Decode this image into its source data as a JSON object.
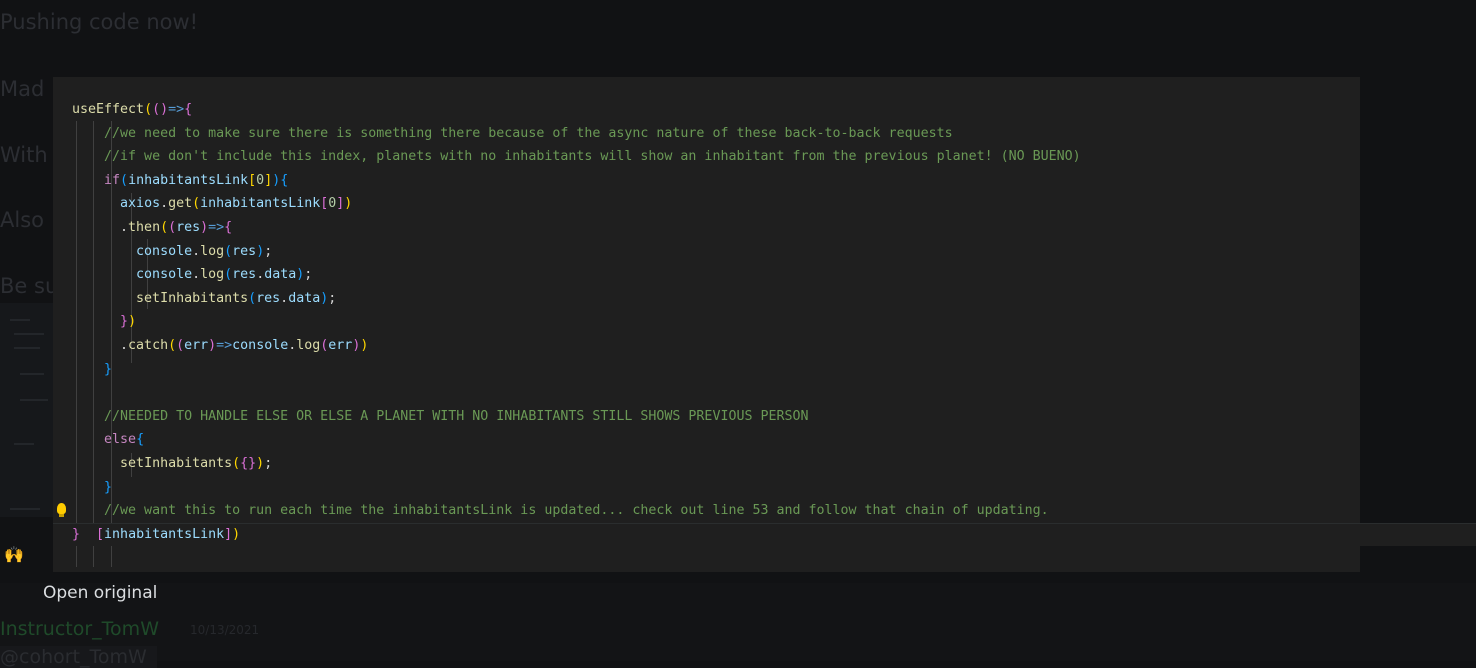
{
  "background_chat": {
    "lines": [
      "Pushing code now!",
      "Mad",
      "With",
      "Also",
      "Be su"
    ],
    "author": "Instructor_TomW",
    "date": "10/13/2021",
    "mention": "@cohort_TomW"
  },
  "viewer": {
    "open_original_label": "Open original",
    "code_lines": [
      "useEffect(()=>{",
      "    //we need to make sure there is something there because of the async nature of these back-to-back requests",
      "    //if we don't include this index, planets with no inhabitants will show an inhabitant from the previous planet! (NO BUENO)",
      "    if(inhabitantsLink[0]){",
      "      axios.get(inhabitantsLink[0])",
      "      .then((res)=>{",
      "        console.log(res);",
      "        console.log(res.data);",
      "        setInhabitants(res.data);",
      "      })",
      "      .catch((err)=>console.log(err))",
      "    }",
      "",
      "    //NEEDED TO HANDLE ELSE OR ELSE A PLANET WITH NO INHABITANTS STILL SHOWS PREVIOUS PERSON",
      "    else{",
      "      setInhabitants({});",
      "    }",
      "    //we want this to run each time the inhabitantsLink is updated... check out line 53 and follow that chain of updating.",
      "}, [inhabitantsLink])"
    ]
  },
  "colors": {
    "keyword": "#c586c0",
    "function": "#dcdcaa",
    "variable": "#9cdcfe",
    "comment": "#6a9955",
    "bracket_gold": "#ffd700",
    "bracket_orchid": "#da70d6",
    "bracket_blue": "#179fff"
  }
}
